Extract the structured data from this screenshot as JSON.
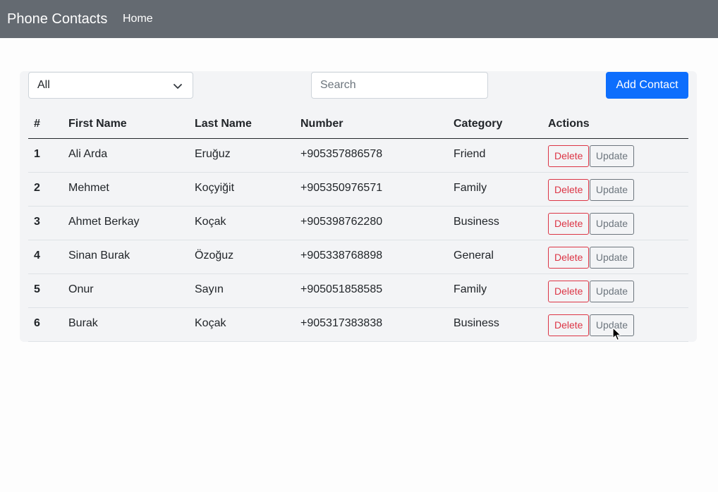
{
  "navbar": {
    "brand": "Phone Contacts",
    "home": "Home",
    "bg": "#646a71"
  },
  "toolbar": {
    "filter_selected": "All",
    "search_placeholder": "Search",
    "add_label": "Add Contact",
    "add_color": "#0d6efd"
  },
  "table": {
    "headers": [
      "#",
      "First Name",
      "Last Name",
      "Number",
      "Category",
      "Actions"
    ],
    "rows": [
      {
        "id": "1",
        "first": "Ali Arda",
        "last": "Eruğuz",
        "number": "+905357886578",
        "category": "Friend"
      },
      {
        "id": "2",
        "first": "Mehmet",
        "last": "Koçyiğit",
        "number": "+905350976571",
        "category": "Family"
      },
      {
        "id": "3",
        "first": "Ahmet Berkay",
        "last": "Koçak",
        "number": "+905398762280",
        "category": "Business"
      },
      {
        "id": "4",
        "first": "Sinan Burak",
        "last": "Özoğuz",
        "number": "+905338768898",
        "category": "General"
      },
      {
        "id": "5",
        "first": "Onur",
        "last": "Sayın",
        "number": "+905051858585",
        "category": "Family"
      },
      {
        "id": "6",
        "first": "Burak",
        "last": "Koçak",
        "number": "+905317383838",
        "category": "Business"
      }
    ],
    "delete_label": "Delete",
    "update_label": "Update",
    "delete_color": "#dc3545",
    "update_color": "#6c757d"
  },
  "icons": {
    "select_chevron": "chevron-down-icon",
    "mouse_cursor": "cursor-arrow-icon"
  }
}
